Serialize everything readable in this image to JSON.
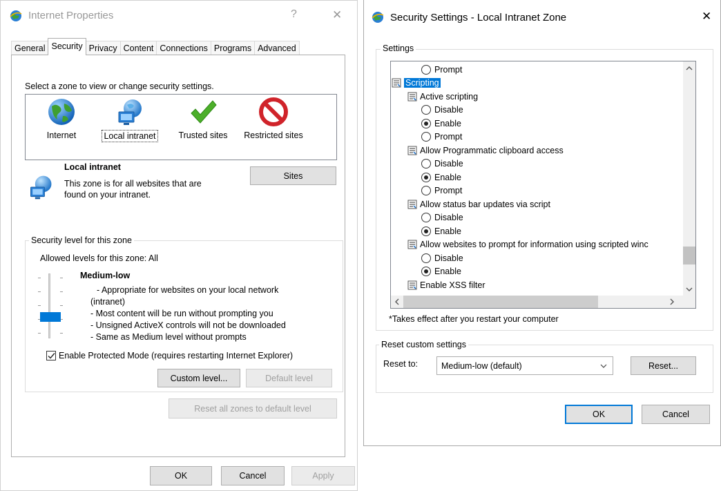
{
  "left_window": {
    "title": "Internet Properties",
    "help_glyph": "?",
    "close_glyph": "✕",
    "tabs": [
      "General",
      "Security",
      "Privacy",
      "Content",
      "Connections",
      "Programs",
      "Advanced"
    ],
    "active_tab": "Security",
    "zone_prompt": "Select a zone to view or change security settings.",
    "zones": [
      {
        "label": "Internet",
        "icon": "globe-icon"
      },
      {
        "label": "Local intranet",
        "icon": "intranet-globe-icon",
        "selected": true
      },
      {
        "label": "Trusted sites",
        "icon": "checkmark-icon"
      },
      {
        "label": "Restricted sites",
        "icon": "restricted-icon"
      }
    ],
    "zone_info": {
      "title": "Local intranet",
      "description_line1": "This zone is for all websites that are",
      "description_line2": "found on your intranet.",
      "sites_button": "Sites"
    },
    "security_level": {
      "group_label": "Security level for this zone",
      "allowed_levels": "Allowed levels for this zone: All",
      "level_name": "Medium-low",
      "lines": [
        "- Appropriate for websites on your local network",
        "(intranet)",
        "- Most content will be run without prompting you",
        "- Unsigned ActiveX controls will not be downloaded",
        "- Same as Medium level without prompts"
      ],
      "protected_mode_label": "Enable Protected Mode (requires restarting Internet Explorer)",
      "protected_mode_checked": true,
      "custom_level_button": "Custom level...",
      "default_level_button": "Default level"
    },
    "reset_all_button": "Reset all zones to default level",
    "footer": {
      "ok": "OK",
      "cancel": "Cancel",
      "apply": "Apply"
    }
  },
  "right_window": {
    "title": "Security Settings - Local Intranet Zone",
    "close_glyph": "✕",
    "settings_group_label": "Settings",
    "tree_rows": [
      {
        "type": "radio",
        "label": "Prompt",
        "checked": false
      },
      {
        "type": "category",
        "label": "Scripting",
        "selected": true
      },
      {
        "type": "setting",
        "label": "Active scripting"
      },
      {
        "type": "radio",
        "label": "Disable",
        "checked": false
      },
      {
        "type": "radio",
        "label": "Enable",
        "checked": true
      },
      {
        "type": "radio",
        "label": "Prompt",
        "checked": false
      },
      {
        "type": "setting",
        "label": "Allow Programmatic clipboard access"
      },
      {
        "type": "radio",
        "label": "Disable",
        "checked": false
      },
      {
        "type": "radio",
        "label": "Enable",
        "checked": true
      },
      {
        "type": "radio",
        "label": "Prompt",
        "checked": false
      },
      {
        "type": "setting",
        "label": "Allow status bar updates via script"
      },
      {
        "type": "radio",
        "label": "Disable",
        "checked": false
      },
      {
        "type": "radio",
        "label": "Enable",
        "checked": true
      },
      {
        "type": "setting",
        "label": "Allow websites to prompt for information using scripted winc"
      },
      {
        "type": "radio",
        "label": "Disable",
        "checked": false
      },
      {
        "type": "radio",
        "label": "Enable",
        "checked": true
      },
      {
        "type": "setting",
        "label": "Enable XSS filter"
      }
    ],
    "note": "*Takes effect after you restart your computer",
    "reset_group_label": "Reset custom settings",
    "reset_to_label": "Reset to:",
    "reset_to_value": "Medium-low (default)",
    "reset_button": "Reset...",
    "ok": "OK",
    "cancel": "Cancel"
  },
  "colors": {
    "accent": "#0078d7",
    "slider_thumb": "#0078d7"
  }
}
